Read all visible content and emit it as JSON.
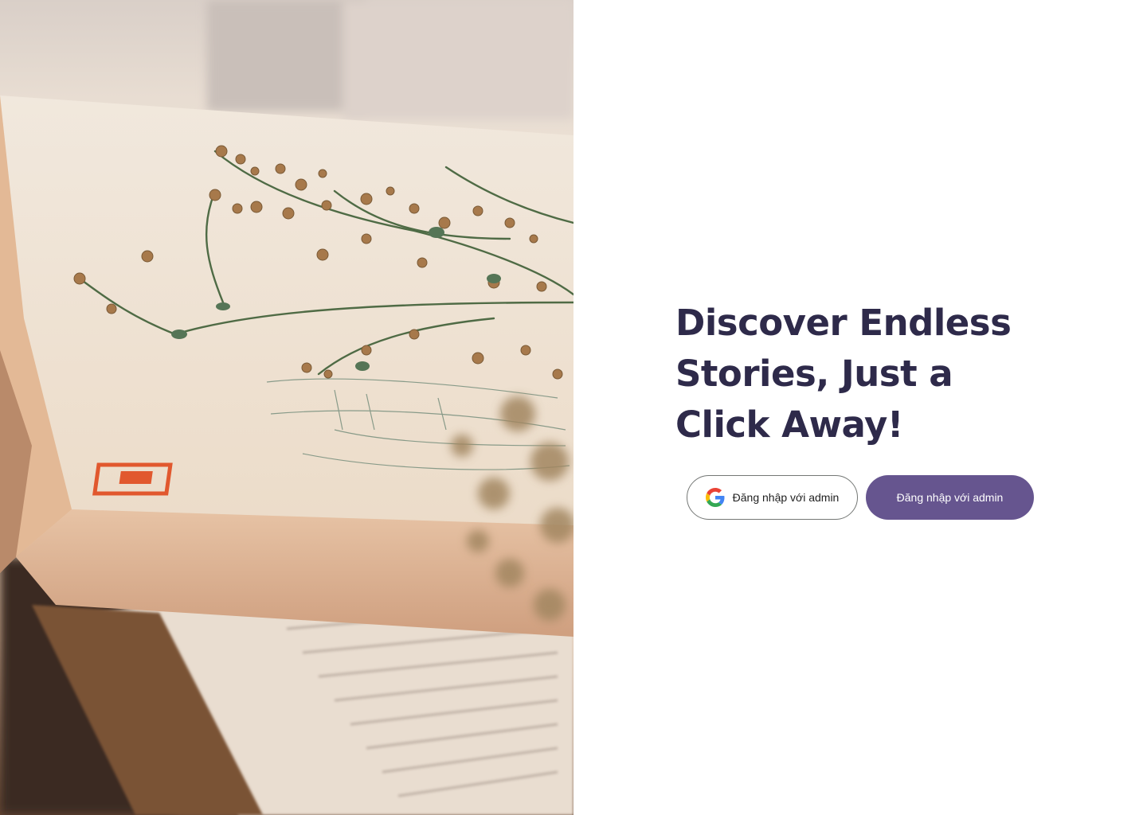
{
  "hero": {
    "image_description_icon": "book-with-dried-flowers-photo"
  },
  "headline": "Discover Endless Stories, Just a Click Away!",
  "actions": {
    "google_button_label": "Đăng nhập với admin",
    "primary_button_label": "Đăng nhập với admin"
  },
  "colors": {
    "headline": "#2e2a4a",
    "primary_button": "#66558f",
    "google_button_border": "#747775"
  }
}
